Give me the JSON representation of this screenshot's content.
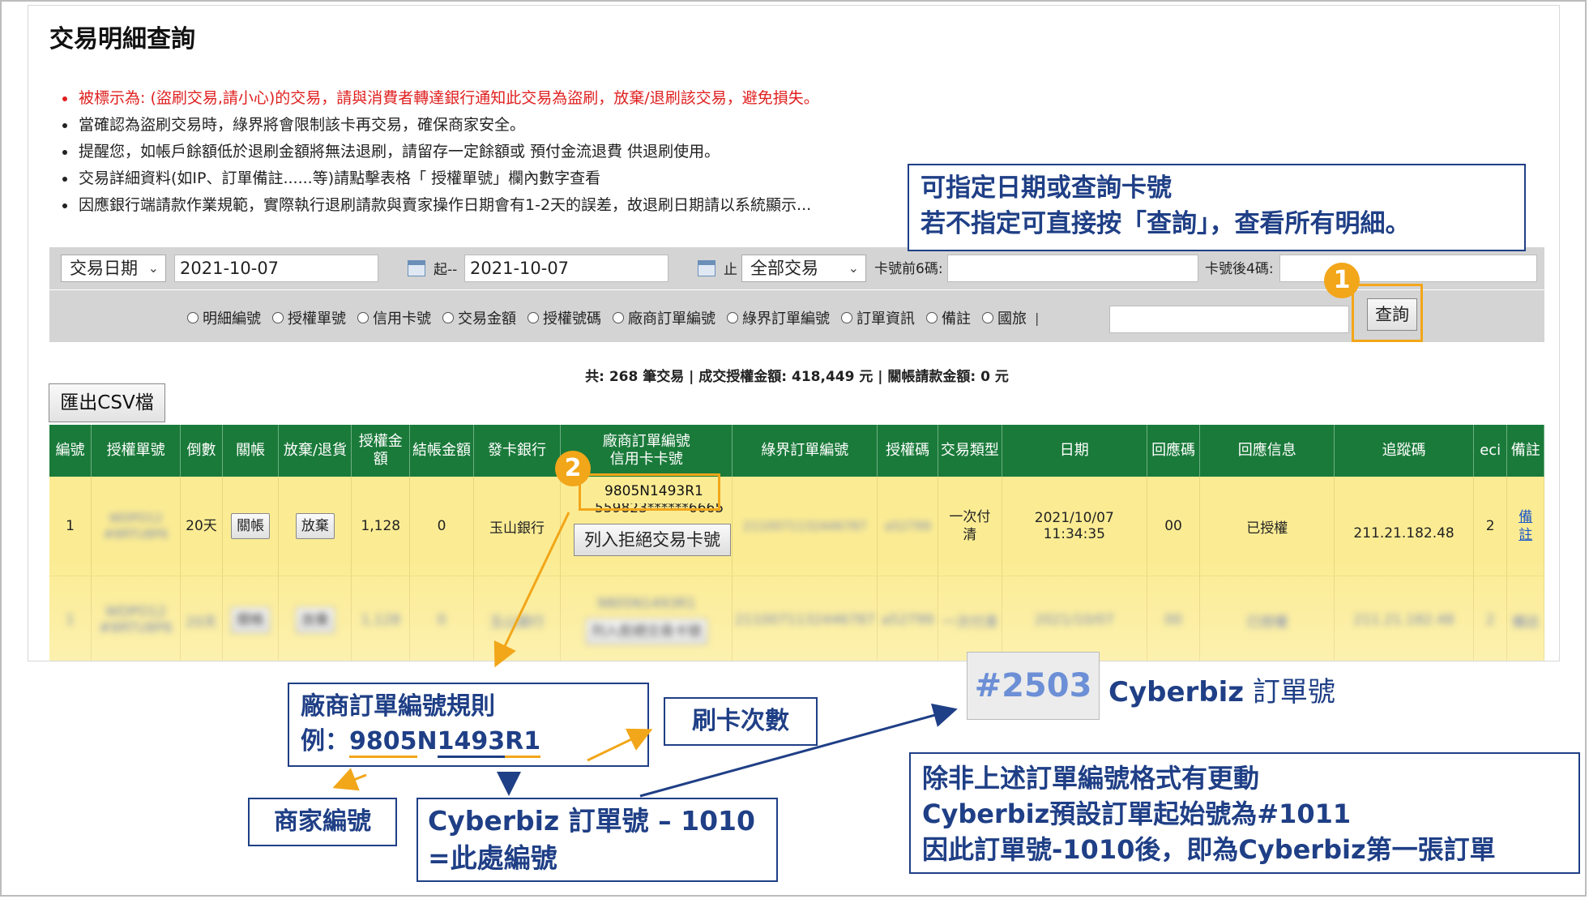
{
  "title": "交易明細查詢",
  "notes": [
    "被標示為: (盜刷交易,請小心)的交易，請與消費者轉達銀行通知此交易為盜刷，放棄/退刷該交易，避免損失。",
    "當確認為盜刷交易時，綠界將會限制該卡再交易，確保商家安全。",
    "提醒您，如帳戶餘額低於退刷金額將無法退刷，請留存一定餘額或 預付金流退費 供退刷使用。",
    "交易詳細資料(如IP、訂單備註......等)請點擊表格「 授權單號」欄內數字查看",
    "因應銀行端請款作業規範，實際執行退刷請款與賣家操作日期會有1-2天的誤差，故退刷日期請以系統顯示..."
  ],
  "filter": {
    "date_type": "交易日期",
    "start_date": "2021-10-07",
    "start_label": "起--",
    "end_date": "2021-10-07",
    "end_label": "止",
    "trade_type": "全部交易",
    "card_first6_label": "卡號前6碼:",
    "card_last4_label": "卡號後4碼:"
  },
  "search": {
    "options": [
      "明細編號",
      "授權單號",
      "信用卡號",
      "交易金額",
      "授權號碼",
      "廠商訂單編號",
      "綠界訂單編號",
      "訂單資訊",
      "備註",
      "國旅"
    ],
    "separator": "|",
    "query_label": "查詢"
  },
  "summary": "共: 268 筆交易 | 成交授權金額: 418,449 元 | 關帳請款金額: 0 元",
  "export_label": "匯出CSV檔",
  "table": {
    "headers": [
      "編號",
      "授權單號",
      "倒數",
      "關帳",
      "放棄/退貨",
      "授權金額",
      "結帳金額",
      "發卡銀行",
      "廠商訂單編號\n信用卡卡號",
      "綠界訂單編號",
      "授權碼",
      "交易類型",
      "日期",
      "回應碼",
      "回應信息",
      "追蹤碼",
      "eci",
      "備註"
    ],
    "row1": {
      "no": "1",
      "auth_no": "WDPO12 #8RTU8P6",
      "countdown": "20天",
      "close_btn": "關帳",
      "cancel_btn": "放棄",
      "auth_amount": "1,128",
      "settle_amount": "0",
      "bank": "玉山銀行",
      "order_no": "9805N1493R1",
      "card_no": "559823******6665",
      "reject_btn": "列入拒絕交易卡號",
      "ecpay_no": "2110071132446787",
      "auth_code": "a52799",
      "trade_type": "一次付清",
      "date": "2021/10/07",
      "time": "11:34:35",
      "resp_code": "00",
      "resp_msg": "已授權",
      "trace": "211.21.182.48",
      "eci": "2",
      "remark": "備註"
    }
  },
  "callouts": {
    "date_line1": "可指定日期或查詢卡號",
    "date_line2": "若不指定可直接按「查詢」，查看所有明細。",
    "rule_line1": "廠商訂單編號規則",
    "rule_prefix": "例：",
    "rule_seg1": "9805",
    "rule_seg2": "N",
    "rule_seg3": "1493",
    "rule_seg4": "R1",
    "swipe": "刷卡次數",
    "merchant": "商家編號",
    "cyberbiz_line1": "Cyberbiz 訂單號 – 1010",
    "cyberbiz_line2": "=此處編號",
    "default_line1": "除非上述訂單編號格式有更動",
    "default_line2": "Cyberbiz預設訂單起始號為#1011",
    "default_line3": "因此訂單號-1010後，即為Cyberbiz第一張訂單",
    "sample_order": "#2503",
    "sample_label_bold": "Cyberbiz",
    "sample_label_rest": "訂單號"
  },
  "badges": {
    "one": "1",
    "two": "2"
  },
  "colors": {
    "accent_orange": "#f2a619",
    "navy": "#1f3f86",
    "table_header": "#1a7a3a",
    "row_yellow": "#fbec94",
    "warning_red": "#e02020"
  }
}
